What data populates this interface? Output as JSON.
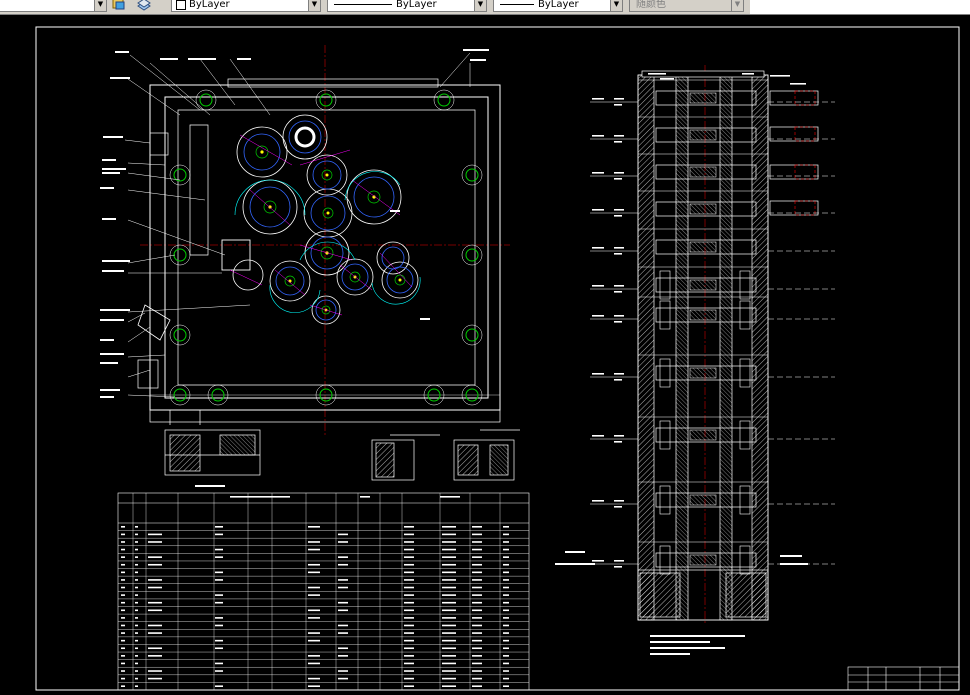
{
  "toolbar": {
    "layer_prop_value": "ByLayer",
    "linetype_value": "ByLayer",
    "lineweight_value": "ByLayer",
    "color_value": "随颜色"
  }
}
